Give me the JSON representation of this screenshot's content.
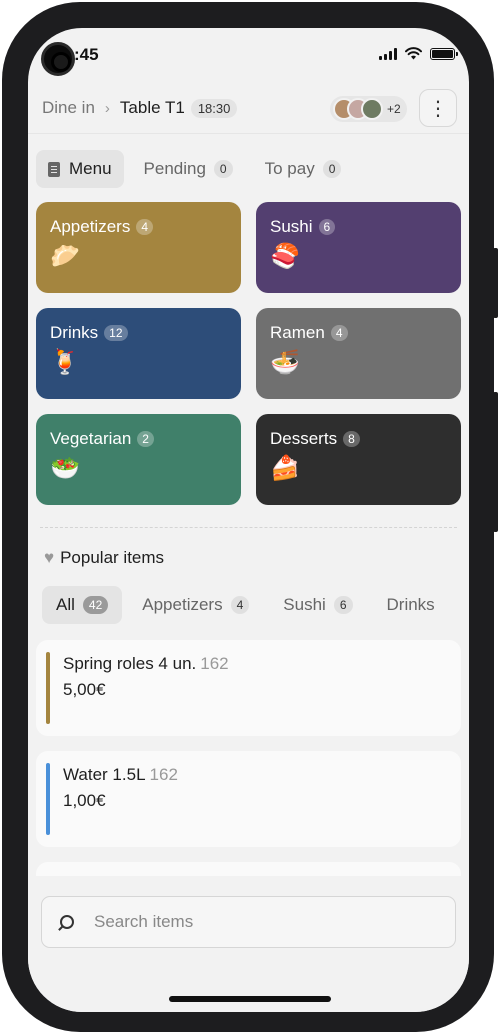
{
  "status_bar": {
    "time": ":45",
    "icons": [
      "signal-icon",
      "wifi-icon",
      "battery-icon"
    ]
  },
  "header": {
    "breadcrumb_parent": "Dine in",
    "breadcrumb_current": "Table T1",
    "time_badge": "18:30",
    "avatars_extra": "+2",
    "more_label": "⋮"
  },
  "tabs": [
    {
      "label": "Menu",
      "count": ""
    },
    {
      "label": "Pending",
      "count": "0"
    },
    {
      "label": "To pay",
      "count": "0"
    }
  ],
  "categories": [
    {
      "name": "Appetizers",
      "count": "4",
      "emoji": "🥟",
      "color": "#A4853F"
    },
    {
      "name": "Sushi",
      "count": "6",
      "emoji": "🍣",
      "color": "#533F70"
    },
    {
      "name": "Drinks",
      "count": "12",
      "emoji": "🍹",
      "color": "#2D4D79"
    },
    {
      "name": "Ramen",
      "count": "4",
      "emoji": "🍜",
      "color": "#707070"
    },
    {
      "name": "Vegetarian",
      "count": "2",
      "emoji": "🥗",
      "color": "#40806A"
    },
    {
      "name": "Desserts",
      "count": "8",
      "emoji": "🍰",
      "color": "#2E2E2E"
    }
  ],
  "popular": {
    "title": "Popular items",
    "filters": [
      {
        "label": "All",
        "count": "42"
      },
      {
        "label": "Appetizers",
        "count": "4"
      },
      {
        "label": "Sushi",
        "count": "6"
      },
      {
        "label": "Drinks",
        "count": ""
      }
    ],
    "items": [
      {
        "name": "Spring roles 4 un.",
        "code": "162",
        "price": "5,00€",
        "bar_color": "#A4853F"
      },
      {
        "name": "Water 1.5L",
        "code": "162",
        "price": "1,00€",
        "bar_color": "#4A90D9"
      }
    ]
  },
  "search": {
    "placeholder": "Search items"
  }
}
